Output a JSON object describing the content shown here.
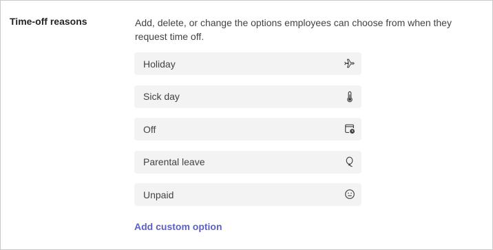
{
  "section": {
    "title": "Time-off reasons",
    "description": "Add, delete, or change the options employees can choose from when they request time off."
  },
  "options": [
    {
      "label": "Holiday",
      "icon": "airplane-icon"
    },
    {
      "label": "Sick day",
      "icon": "thermometer-icon"
    },
    {
      "label": "Off",
      "icon": "calendar-clock-icon"
    },
    {
      "label": "Parental leave",
      "icon": "balloon-icon"
    },
    {
      "label": "Unpaid",
      "icon": "neutral-face-icon"
    }
  ],
  "add_option": {
    "label": "Add custom option"
  },
  "colors": {
    "link": "#5b5fc7",
    "field_bg": "#f3f3f3",
    "text": "#242424",
    "border": "#c8c8c8"
  }
}
